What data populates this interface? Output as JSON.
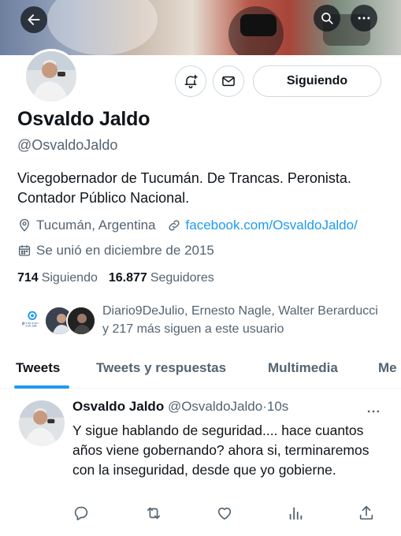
{
  "profile": {
    "name": "Osvaldo Jaldo",
    "handle": "@OsvaldoJaldo",
    "bio": "Vicegobernador de Tucumán. De Trancas. Peronista. Contador Público Nacional.",
    "location": "Tucumán, Argentina",
    "website": "facebook.com/OsvaldoJaldo/",
    "joined": "Se unió en diciembre de 2015",
    "following_count": "714",
    "following_label": "Siguiendo",
    "followers_count": "16.877",
    "followers_label": "Seguidores",
    "follow_button": "Siguiendo",
    "known_followers": "Diario9DeJulio, Ernesto Nagle, Walter Berarducci y 217 más siguen a este usuario"
  },
  "mini_logo": {
    "top": "9 DE JULIO",
    "bottom": "9 de Julio"
  },
  "tabs": [
    {
      "label": "Tweets"
    },
    {
      "label": "Tweets y respuestas"
    },
    {
      "label": "Multimedia"
    },
    {
      "label": "Me"
    }
  ],
  "tweet": {
    "name": "Osvaldo Jaldo",
    "handle": "@OsvaldoJaldo",
    "separator": "·",
    "time": "10s",
    "text": "Y sigue hablando de seguridad.... hace cuantos años viene gobernando? ahora si, terminaremos con la inseguridad, desde que yo gobierne."
  },
  "icons": [
    "back-arrow-icon",
    "search-icon",
    "more-icon",
    "bell-plus-icon",
    "mail-icon",
    "location-icon",
    "link-icon",
    "calendar-icon",
    "reply-icon",
    "retweet-icon",
    "like-icon",
    "views-icon",
    "share-icon"
  ],
  "colors": {
    "accent": "#1d9bf0",
    "text": "#0f1419",
    "secondary": "#536471",
    "border": "#cfd9de"
  }
}
